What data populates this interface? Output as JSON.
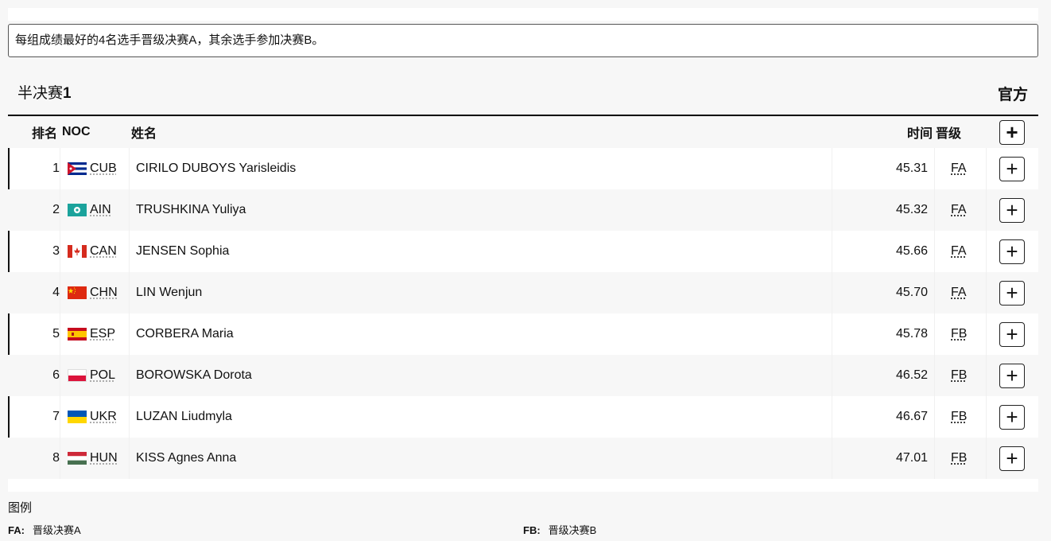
{
  "notice": "每组成绩最好的4名选手晋级决赛A，其余选手参加决赛B。",
  "heat": {
    "title_prefix": "半决赛",
    "title_number": "1",
    "status": "官方"
  },
  "table": {
    "headers": {
      "rank": "排名",
      "noc": "NOC",
      "name": "姓名",
      "time": "时间",
      "qual": "晋级",
      "expand": "+"
    },
    "rows": [
      {
        "rank": "1",
        "noc": "CUB",
        "flag": "cuba-flag-icon",
        "name": "CIRILO DUBOYS Yarisleidis",
        "time": "45.31",
        "qual": "FA"
      },
      {
        "rank": "2",
        "noc": "AIN",
        "flag": "ain-flag-icon",
        "name": "TRUSHKINA Yuliya",
        "time": "45.32",
        "qual": "FA"
      },
      {
        "rank": "3",
        "noc": "CAN",
        "flag": "canada-flag-icon",
        "name": "JENSEN Sophia",
        "time": "45.66",
        "qual": "FA"
      },
      {
        "rank": "4",
        "noc": "CHN",
        "flag": "china-flag-icon",
        "name": "LIN Wenjun",
        "time": "45.70",
        "qual": "FA"
      },
      {
        "rank": "5",
        "noc": "ESP",
        "flag": "spain-flag-icon",
        "name": "CORBERA Maria",
        "time": "45.78",
        "qual": "FB"
      },
      {
        "rank": "6",
        "noc": "POL",
        "flag": "poland-flag-icon",
        "name": "BOROWSKA Dorota",
        "time": "46.52",
        "qual": "FB"
      },
      {
        "rank": "7",
        "noc": "UKR",
        "flag": "ukraine-flag-icon",
        "name": "LUZAN Liudmyla",
        "time": "46.67",
        "qual": "FB"
      },
      {
        "rank": "8",
        "noc": "HUN",
        "flag": "hungary-flag-icon",
        "name": "KISS Agnes Anna",
        "time": "47.01",
        "qual": "FB"
      }
    ],
    "expand_label": "+"
  },
  "legend": {
    "title": "图例",
    "items": [
      {
        "code": "FA:",
        "desc": "晋级决赛A"
      },
      {
        "code": "FB:",
        "desc": "晋级决赛B"
      }
    ]
  }
}
